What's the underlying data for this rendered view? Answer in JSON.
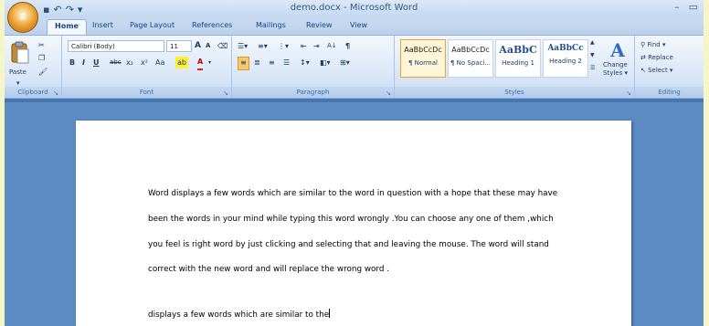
{
  "window": {
    "title": "demo.docx - Microsoft Word",
    "minimize": "–",
    "restore": "▭"
  },
  "tabs": [
    "Home",
    "Insert",
    "Page Layout",
    "References",
    "Mailings",
    "Review",
    "View"
  ],
  "ribbon": {
    "clipboard": {
      "label": "Clipboard",
      "paste_label": "Paste"
    },
    "font": {
      "label": "Font",
      "font_name": "Calibri (Body)",
      "font_size": "11",
      "grow": "A",
      "shrink": "A",
      "bold": "B",
      "italic": "I",
      "underline": "U",
      "strike": "abc",
      "subscript": "x₂",
      "superscript": "x²",
      "change_case": "Aa",
      "font_color": "A"
    },
    "paragraph": {
      "label": "Paragraph",
      "sort": "A↓",
      "pilcrow": "¶"
    },
    "styles": {
      "label": "Styles",
      "items": [
        {
          "sample": "AaBbCcDc",
          "name": "¶ Normal"
        },
        {
          "sample": "AaBbCcDc",
          "name": "¶ No Spaci..."
        },
        {
          "sample": "AaBbC",
          "name": "Heading 1"
        },
        {
          "sample": "AaBbCc",
          "name": "Heading 2"
        }
      ],
      "change_styles_line1": "Change",
      "change_styles_line2": "Styles ▾"
    },
    "editing": {
      "label": "Editing",
      "find": "Find ▾",
      "replace": "Replace",
      "select": "Select ▾"
    }
  },
  "document": {
    "lines": [
      "Word displays a few words which are similar to the word in question with a hope that these may have",
      "been the words in your mind while typing this word wrongly .You can choose any one of them ,which",
      "you feel  is right word by just clicking and selecting that and leaving the mouse. The word will stand",
      "correct with the new word and will replace the wrong word ."
    ],
    "current_line": "displays a few words which are similar to the"
  },
  "colors": {
    "background": "#f6f5c8",
    "workspace": "#5d8bc3",
    "ribbon_label": "#3e6aaa"
  }
}
